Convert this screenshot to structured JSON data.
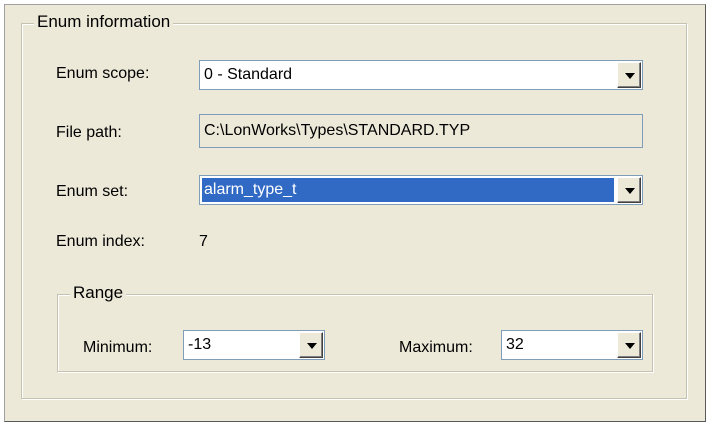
{
  "enum_information": {
    "title": "Enum information",
    "scope_label": "Enum scope:",
    "scope_value": "0 - Standard",
    "file_path_label": "File path:",
    "file_path_value": "C:\\LonWorks\\Types\\STANDARD.TYP",
    "set_label": "Enum set:",
    "set_value": "alarm_type_t",
    "index_label": "Enum index:",
    "index_value": "7"
  },
  "range": {
    "title": "Range",
    "minimum_label": "Minimum:",
    "minimum_value": "-13",
    "maximum_label": "Maximum:",
    "maximum_value": "32"
  },
  "icons": {
    "dropdown": "chevron-down-icon"
  },
  "colors": {
    "dialog_bg": "#ece9d8",
    "selection": "#316ac5",
    "input_border": "#7f9db9"
  }
}
